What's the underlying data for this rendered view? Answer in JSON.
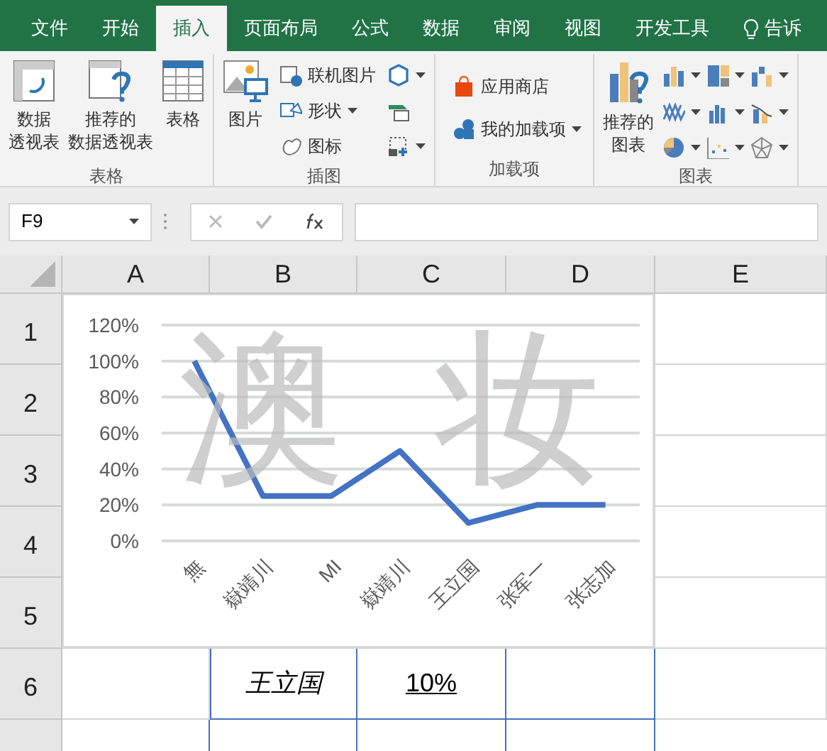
{
  "ribbon": {
    "tabs": [
      {
        "label": "文件",
        "selected": false
      },
      {
        "label": "开始",
        "selected": false
      },
      {
        "label": "插入",
        "selected": true
      },
      {
        "label": "页面布局",
        "selected": false
      },
      {
        "label": "公式",
        "selected": false
      },
      {
        "label": "数据",
        "selected": false
      },
      {
        "label": "审阅",
        "selected": false
      },
      {
        "label": "视图",
        "selected": false
      },
      {
        "label": "开发工具",
        "selected": false
      }
    ],
    "tell_me": "告诉",
    "groups": [
      {
        "label": "表格",
        "items": [
          {
            "kind": "large",
            "lines": [
              "数据",
              "透视表"
            ]
          },
          {
            "kind": "large",
            "lines": [
              "推荐的",
              "数据透视表"
            ]
          },
          {
            "kind": "large",
            "lines": [
              "表格"
            ]
          }
        ]
      },
      {
        "label": "插图",
        "items": [
          {
            "kind": "large",
            "lines": [
              "图片"
            ]
          },
          {
            "kind": "small",
            "label": "联机图片",
            "dropdown": false
          },
          {
            "kind": "small",
            "label": "形状",
            "dropdown": true
          },
          {
            "kind": "small",
            "label": "图标",
            "dropdown": false
          },
          {
            "kind": "icon",
            "dropdown": true
          },
          {
            "kind": "icon",
            "dropdown": false
          },
          {
            "kind": "icon",
            "dropdown": true
          }
        ]
      },
      {
        "label": "加载项",
        "items": [
          {
            "kind": "small",
            "label": "应用商店",
            "dropdown": false
          },
          {
            "kind": "small",
            "label": "我的加载项",
            "dropdown": true
          }
        ]
      },
      {
        "label": "图表",
        "items": [
          {
            "kind": "large",
            "lines": [
              "推荐的",
              "图表"
            ]
          },
          {
            "kind": "icon",
            "dropdown": true
          },
          {
            "kind": "icon",
            "dropdown": true
          },
          {
            "kind": "icon",
            "dropdown": true
          },
          {
            "kind": "icon",
            "dropdown": true
          },
          {
            "kind": "icon",
            "dropdown": true
          },
          {
            "kind": "icon",
            "dropdown": true
          },
          {
            "kind": "icon",
            "dropdown": true
          },
          {
            "kind": "icon",
            "dropdown": true
          },
          {
            "kind": "icon",
            "dropdown": true
          }
        ]
      }
    ]
  },
  "formula_bar": {
    "name_box": "F9"
  },
  "sheet": {
    "columns": [
      "A",
      "B",
      "C",
      "D",
      "E"
    ],
    "rows": [
      {
        "label": "1"
      },
      {
        "label": "2"
      },
      {
        "label": "3"
      },
      {
        "label": "4"
      },
      {
        "label": "5"
      },
      {
        "label": "6",
        "cells": [
          null,
          {
            "text": "王立国",
            "italic": true,
            "underline": false
          },
          {
            "text": "10%",
            "italic": false,
            "underline": true
          },
          null,
          null
        ]
      }
    ]
  },
  "chart": {
    "background_text": [
      "澳",
      "妆"
    ],
    "chart_data": {
      "type": "line",
      "grid": true,
      "categories": [
        "無",
        "嶽靖川",
        "MI",
        "嶽靖川",
        "王立国",
        "张军一",
        "张志加"
      ],
      "series": [
        {
          "color": "#4472c4",
          "values": [
            1,
            0.25,
            0.25,
            0.5,
            0.1,
            0.2,
            0.2
          ]
        }
      ],
      "ylim": [
        0,
        1.2
      ],
      "yticks": [
        {
          "value": 0,
          "label": "0%"
        },
        {
          "value": 0.2,
          "label": "20%"
        },
        {
          "value": 0.4,
          "label": "40%"
        },
        {
          "value": 0.6,
          "label": "60%"
        },
        {
          "value": 0.8,
          "label": "80%"
        },
        {
          "value": 1,
          "label": "100%"
        },
        {
          "value": 1.2,
          "label": "120%"
        }
      ]
    }
  }
}
